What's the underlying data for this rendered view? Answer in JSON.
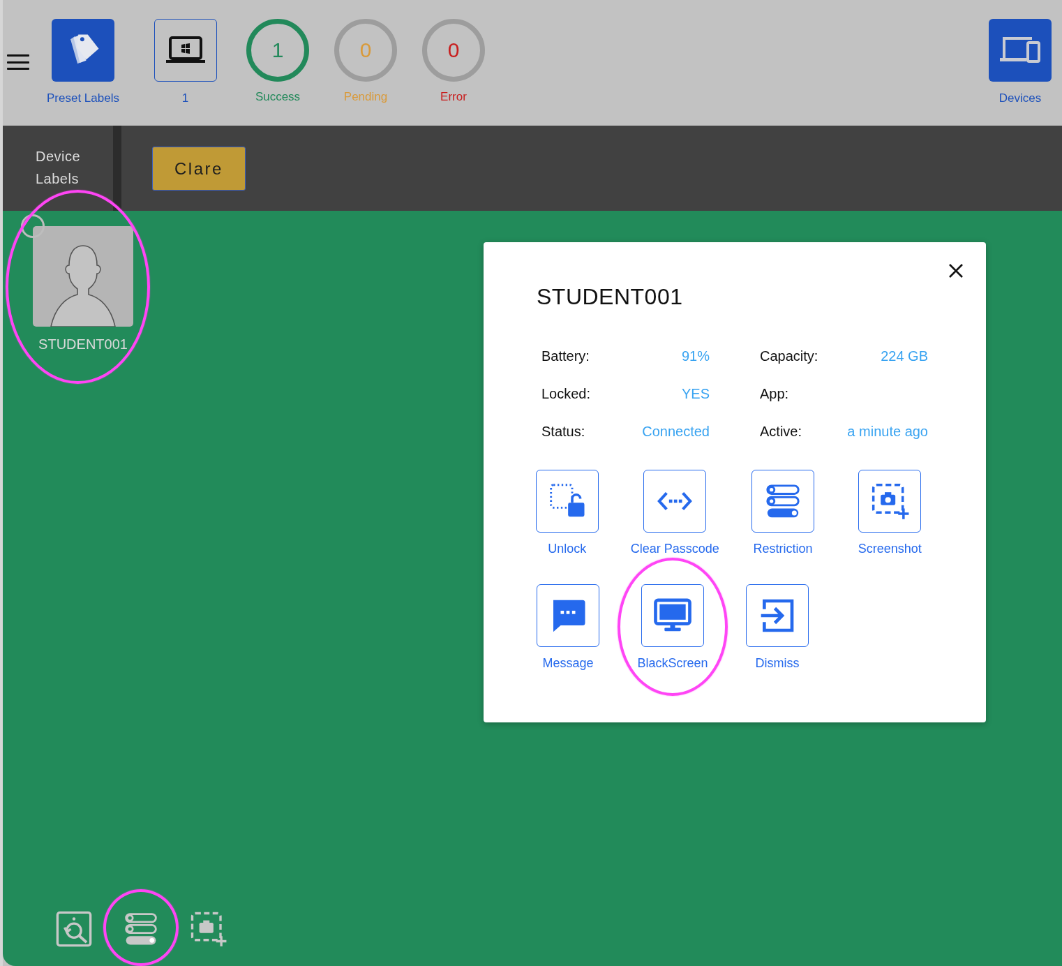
{
  "toolbar": {
    "preset_labels": {
      "label": "Preset Labels"
    },
    "device_count": {
      "label": "1"
    },
    "statuses": [
      {
        "count": "1",
        "label": "Success",
        "color": "#22895a",
        "done": true
      },
      {
        "count": "0",
        "label": "Pending",
        "color": "#d99a3a",
        "done": false
      },
      {
        "count": "0",
        "label": "Error",
        "color": "#c81e1e",
        "done": false
      }
    ],
    "devices": {
      "label": "Devices"
    }
  },
  "label_bar": {
    "title": "Device Labels",
    "labels": [
      {
        "label": "Clare"
      }
    ]
  },
  "devices": [
    {
      "name": "STUDENT001",
      "selected": false,
      "circled": true
    }
  ],
  "device_dialog": {
    "title": "STUDENT001",
    "info": [
      {
        "label": "Battery:",
        "value": "91%"
      },
      {
        "label": "Capacity:",
        "value": "224 GB"
      },
      {
        "label": "Locked:",
        "value": "YES"
      },
      {
        "label": "App:"
      },
      {
        "label": "Status:",
        "value": "Connected"
      },
      {
        "label": "Active:",
        "value": "a minute ago"
      }
    ],
    "action_rows": [
      {
        "actions": [
          {
            "kind": "unlock",
            "label": "Unlock",
            "circled": false
          },
          {
            "kind": "clear-passcode",
            "label": "Clear Passcode",
            "circled": false
          },
          {
            "kind": "restriction",
            "label": "Restriction",
            "circled": false
          },
          {
            "kind": "screenshot",
            "label": "Screenshot",
            "circled": false
          }
        ]
      },
      {
        "actions": [
          {
            "kind": "message",
            "label": "Message",
            "circled": false
          },
          {
            "kind": "blackscreen",
            "label": "BlackScreen",
            "circled": true
          },
          {
            "kind": "dismiss",
            "label": "Dismiss",
            "circled": false
          }
        ]
      }
    ]
  },
  "bottom_tools": [
    {
      "kind": "image-search",
      "circled": false
    },
    {
      "kind": "restriction",
      "circled": true
    },
    {
      "kind": "screenshot",
      "circled": false
    }
  ]
}
